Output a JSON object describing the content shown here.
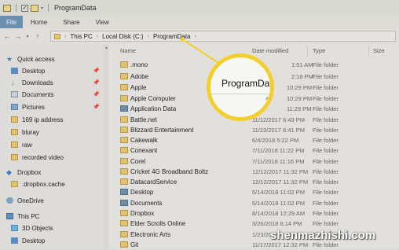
{
  "window": {
    "title": "ProgramData"
  },
  "ribbon": {
    "tabs": [
      "File",
      "Home",
      "Share",
      "View"
    ]
  },
  "address": {
    "crumbs": [
      "This PC",
      "Local Disk (C:)",
      "ProgramData"
    ]
  },
  "sidebar": {
    "items": [
      {
        "label": "Quick access",
        "icon": "star-icon"
      },
      {
        "label": "Desktop",
        "icon": "desktop-icon"
      },
      {
        "label": "Downloads",
        "icon": "download-icon"
      },
      {
        "label": "Documents",
        "icon": "documents-icon"
      },
      {
        "label": "Pictures",
        "icon": "pictures-icon"
      },
      {
        "label": "169 ip address",
        "icon": "folder-icon"
      },
      {
        "label": "bluray",
        "icon": "folder-icon"
      },
      {
        "label": "raw",
        "icon": "folder-icon"
      },
      {
        "label": "recorded video",
        "icon": "folder-icon"
      },
      {
        "label": "Dropbox",
        "icon": "dropbox-icon"
      },
      {
        "label": ".dropbox.cache",
        "icon": "folder-icon"
      },
      {
        "label": "OneDrive",
        "icon": "cloud-icon"
      },
      {
        "label": "This PC",
        "icon": "computer-icon"
      },
      {
        "label": "3D Objects",
        "icon": "cube-icon"
      },
      {
        "label": "Desktop",
        "icon": "desktop-icon"
      }
    ]
  },
  "columns": {
    "name": "Name",
    "date": "Date modified",
    "type": "Type",
    "size": "Size"
  },
  "files": [
    {
      "name": ".mono",
      "date": "1:51 AM",
      "type": "File folder"
    },
    {
      "name": "Adobe",
      "date": "2:16 PM",
      "type": "File folder"
    },
    {
      "name": "Apple",
      "date": "10:29 PM",
      "type": "File folder"
    },
    {
      "name": "Apple Computer",
      "date": "10:29 PM",
      "type": "File folder"
    },
    {
      "name": "Application Data",
      "date": "11:29 PM",
      "type": "File folder"
    },
    {
      "name": "Battle.net",
      "date": "11/12/2017 6:43 PM",
      "type": "File folder"
    },
    {
      "name": "Blizzard Entertainment",
      "date": "11/23/2017 6:41 PM",
      "type": "File folder"
    },
    {
      "name": "Cakewalk",
      "date": "6/4/2018 5:22 PM",
      "type": "File folder"
    },
    {
      "name": "Conexant",
      "date": "7/11/2018 11:22 PM",
      "type": "File folder"
    },
    {
      "name": "Corel",
      "date": "7/11/2018 11:16 PM",
      "type": "File folder"
    },
    {
      "name": "Cricket 4G Broadband Boltz",
      "date": "12/12/2017 11:32 PM",
      "type": "File folder"
    },
    {
      "name": "DatacardService",
      "date": "12/12/2017 11:32 PM",
      "type": "File folder"
    },
    {
      "name": "Desktop",
      "date": "5/14/2018 11:02 PM",
      "type": "File folder"
    },
    {
      "name": "Documents",
      "date": "5/14/2018 11:02 PM",
      "type": "File folder"
    },
    {
      "name": "Dropbox",
      "date": "8/14/2018 12:29 AM",
      "type": "File folder"
    },
    {
      "name": "Elder Scrolls Online",
      "date": "3/26/2018 6:14 PM",
      "type": "File folder"
    },
    {
      "name": "Electronic Arts",
      "date": "1/23/2018 6:00 PM",
      "type": "File folder"
    },
    {
      "name": "Git",
      "date": "11/17/2017 12:32 PM",
      "type": "File folder"
    }
  ],
  "callout": {
    "text": "ProgramData"
  },
  "watermark": "shenmazhishi.com"
}
